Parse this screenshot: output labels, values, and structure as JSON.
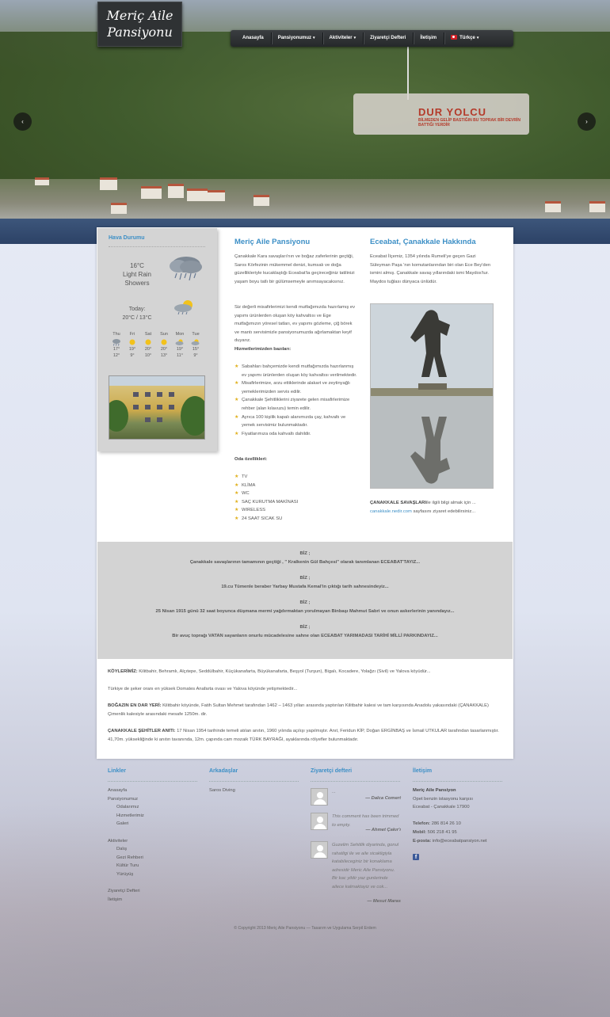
{
  "header": {
    "logo_line1": "Meriç Aile",
    "logo_line2": "Pansiyonu",
    "nav": [
      {
        "label": "Anasayfa",
        "has_caret": false
      },
      {
        "label": "Pansiyonumuz",
        "has_caret": true
      },
      {
        "label": "Aktiviteler",
        "has_caret": true
      },
      {
        "label": "Ziyaretçi Defteri",
        "has_caret": false
      },
      {
        "label": "İletişim",
        "has_caret": false
      },
      {
        "label": "Türkçe",
        "has_caret": true,
        "flag": true
      }
    ],
    "caret": "▾"
  },
  "slider": {
    "prev": "‹",
    "next": "›",
    "monument_title": "DUR YOLCU",
    "monument_sub": "BİLMEDEN GELİP BASTIĞIN BU TOPRAK BİR DEVRİN BATTIĞI YERDİR"
  },
  "weather": {
    "title": "Hava Durumu",
    "current_temp": "16°C",
    "current_cond_1": "Light Rain",
    "current_cond_2": "Showers",
    "today_label": "Today:",
    "today_range": "20°C / 13°C",
    "forecast": [
      {
        "day": "Thu",
        "hi": "17°",
        "lo": "12°",
        "icon": "rain-icon"
      },
      {
        "day": "Fri",
        "hi": "19°",
        "lo": "9°",
        "icon": "sun-icon"
      },
      {
        "day": "Sat",
        "hi": "20°",
        "lo": "10°",
        "icon": "sun-icon"
      },
      {
        "day": "Sun",
        "hi": "20°",
        "lo": "13°",
        "icon": "sun-icon"
      },
      {
        "day": "Mon",
        "hi": "19°",
        "lo": "11°",
        "icon": "partly-cloudy-icon"
      },
      {
        "day": "Tue",
        "hi": "15°",
        "lo": "9°",
        "icon": "partly-cloudy-icon"
      }
    ]
  },
  "about": {
    "title": "Meriç Aile Pansiyonu",
    "p1": "Çanakkale Kara savaşları'nın ve boğaz zaferlerinin geçtiği, Saros Körfezinin mükemmel denizi, kumsalı ve doğa güzellikleriyle kucaklaştığı Eceabat'ta geçireceğiniz tatilinizi yaşam boyu tatlı bir gülümsemeyle anımsayacaksınız.",
    "p2": "Siz değerli misafirlerimizi kendi mutfağımızda hazırlamış ev yapımı ürünlerden oluşan köy kahvaltısı ve Ege mutfağımızın yöresel tatları, ev yapımı gözleme, çiğ börek ve mantı servisimizle pansiyonumuzda ağırlamaktan keyif duyarız.",
    "services_title": "Hizmetlerimizden bazıları:",
    "services": [
      "Sabahları bahçemizde kendi mutfağımızda hazırlanmış ev yapımı ürünlerden oluşan köy kahvaltısı verilmektedir.",
      "Misafirlerimize, arzu ettiklerinde alakart ve zeytinyağlı yemeklerimizden servis edilir.",
      "Çanakkale Şehitliklerini ziyarete gelen misafirlerimize rehber (alan kılavuzu) temin edilir.",
      "Ayrıca 100 kişilik kapalı alanımızda çay, kahvaltı ve yemek servisimiz bulunmaktadır.",
      "Fiyatlarımıza oda kahvaltı dahildir."
    ],
    "room_title": "Oda özellikleri:",
    "room": [
      "TV",
      "KLİMA",
      "WC",
      "SAÇ KURUTMA MAKİNASI",
      "WIRELESS",
      "24 SAAT SICAK SU"
    ]
  },
  "eceabat": {
    "title": "Eceabat, Çanakkale Hakkında",
    "p1": "Eceabat İlçemiz, 1354 yılında Rumeli'ye geçen Gazi Süleyman Paşa 'nın komutanlarından biri olan Ece Bey'den ismini almış. Çanakkale savaş yıllarındaki ismi Maydos'tur. Maydos tuğlası dünyaca ünlüdür.",
    "link_bold": "ÇANAKKALE SAVAŞLARI",
    "link_text": "ile ilgili bilgi almak için ...",
    "link_url": "canakkale.nedir.com",
    "link_after": " sayfasını ziyaret edebilirsiniz..."
  },
  "banner": [
    {
      "head": "BİZ ;",
      "text": "Çanakkale savaşlarının tamamının geçtiği , \" Kralkenin Gül Bahçesi\" olarak tanımlanan ECEABAT'TAYIZ..."
    },
    {
      "head": "BİZ ;",
      "text": "19.cu Tümenle beraber Yarbay Mustafa Kemal'in çıktığı tarih sahnesindeyiz..."
    },
    {
      "head": "BİZ ;",
      "text": "25 Nisan 1915 günü 32 saat boyunca düşmana mermi yağdırmaktan yorulmayan Binbaşı Mahmut Sabri ve onun askerlerinin yanındayız..."
    },
    {
      "head": "BİZ ;",
      "text": "Bir avuç toprağı VATAN sayanların onurlu mücadelesine sahne olan ECEABAT YARIMADASI TARİHİ MİLLİ PARKINDAYIZ..."
    }
  ],
  "lower": {
    "koy_bold": "KÖYLERİMİZ:",
    "koy_text": " Kilitbahir, Behramlı, Alçıtepe, Seddülbahir, Küçükanafarta, Büyükanafarta, Beşyol (Turşun), Bigalı, Kocadere, Yolağzı (Sivil) ve Yalova köyüdür...",
    "domates": "Türkiye de şeker oranı en yüksek Domates Anafarta ovası ve Yalova köyünde yetişmektedir...",
    "bogaz_bold": "BOĞAZIN EN DAR YERİ:",
    "bogaz_text": " Kilitbahir köyünde, Fatih Sultan Mehmet tarafından 1462 – 1463 yılları arasında yaptırılan Kilitbahir kalesi ve tam karşısında Anadolu yakasındaki (ÇANAKKALE) Çimenlik kalesiyle arasındaki mesafe 1250m. dir.",
    "anit_bold": "ÇANAKKALE ŞEHİTLER ANITI:",
    "anit_text": " 17 Nisan 1954 tarihinde temeli atılan anıtın, 1960 yılında açılışı yapılmıştır. Anıt, Feridun KİP, Doğan ERGİNBAŞ ve İsmail UTKULAR tarafından tasarlanmıştır. 41,70m. yüksekliğinde ki anıtın tavanında, 12m. çapında cam mozaik TÜRK BAYRAĞI, ayaklarında rölyefler bulunmaktadır."
  },
  "footer": {
    "links_title": "Linkler",
    "links": [
      {
        "label": "Anasayfa",
        "sub": false
      },
      {
        "label": "Pansiyonumuz",
        "sub": false
      },
      {
        "label": "Odalarımız",
        "sub": true
      },
      {
        "label": "Hizmetlerimiz",
        "sub": true
      },
      {
        "label": "Galeri",
        "sub": true
      },
      {
        "label": "",
        "sub": false
      },
      {
        "label": "Aktiviteler",
        "sub": false
      },
      {
        "label": "Dalış",
        "sub": true
      },
      {
        "label": "Gezi Rehberi",
        "sub": true
      },
      {
        "label": "Kültür Turu",
        "sub": true
      },
      {
        "label": "Yürüyüş",
        "sub": true
      },
      {
        "label": "",
        "sub": false
      },
      {
        "label": "Ziyaretçi Defteri",
        "sub": false
      },
      {
        "label": "İletişim",
        "sub": false
      }
    ],
    "friends_title": "Arkadaşlar",
    "friends": [
      "Saros Diving"
    ],
    "guestbook_title": "Ziyaretçi defteri",
    "comments": [
      {
        "text": "...",
        "author": "— Dalca Comert"
      },
      {
        "text": "This comment has been trimmed to empty.",
        "author": "— Ahmet Çakır'ı"
      },
      {
        "text": "Guzelim Sehitlik diyarinda, gonul rahatligi ile ve aile sicakligiyla katabileceginiz bir konaklama adresidir Meric Aile Pansiyonu. Bir kac yildir yaz gunlerinde ailece kalmaktayiz ve cok...",
        "author": "— Mesut Maras"
      }
    ],
    "contact_title": "İletişim",
    "contact_name": "Meriç Aile Pansiyon",
    "contact_addr1": "Opet benzin istasyonu karşısı",
    "contact_addr2": "Eceabat - Çanakkale 17900",
    "phone_label": "Telefon:",
    "phone": " 286 814 26 10",
    "mobile_label": "Mobil:",
    "mobile": " 506 218 41 95",
    "email_label": "E-posta:",
    "email": " info@eceabatpansiyon.net",
    "fb": "f",
    "copyright": "© Copyright 2013 Meriç Aile Pansiyonu — Tasarım ve Uygulama Serpil Erdem"
  }
}
